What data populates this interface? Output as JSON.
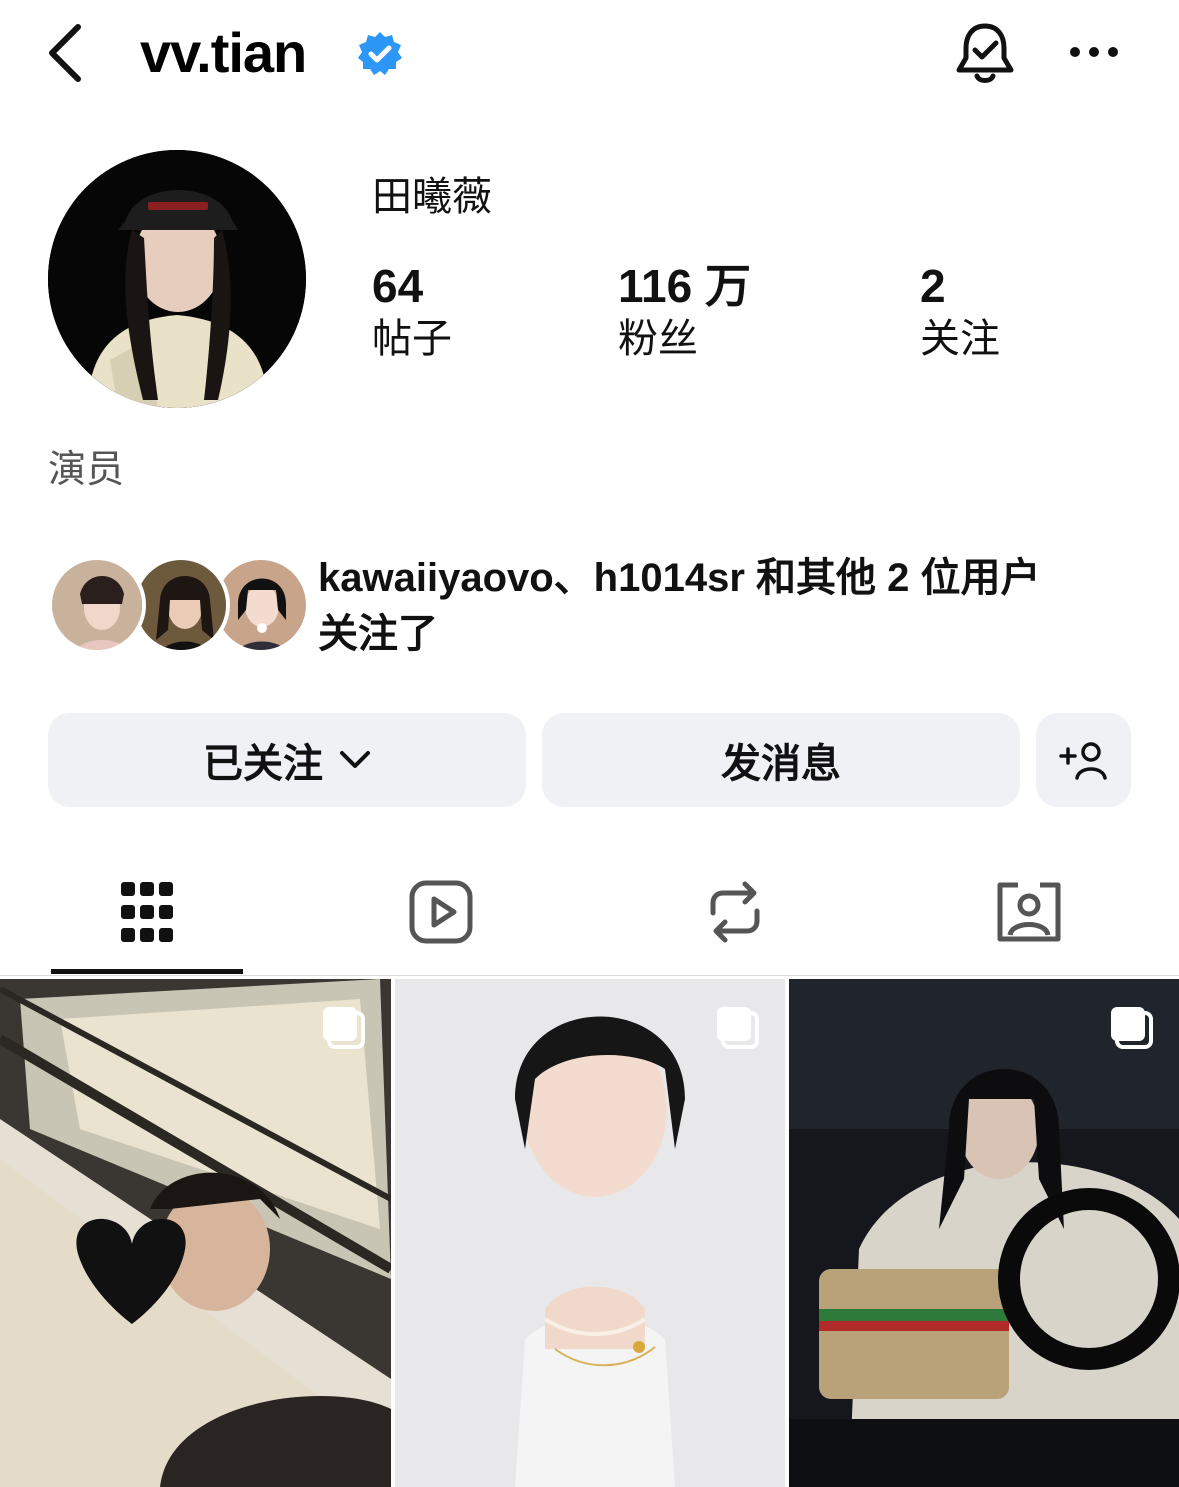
{
  "header": {
    "username": "vv.tian",
    "verified": true,
    "icons": [
      "back-arrow-icon",
      "verified-badge-icon",
      "notification-bell-icon",
      "more-options-icon"
    ]
  },
  "profile": {
    "display_name": "田曦薇",
    "stats": [
      {
        "value": "64",
        "label": "帖子"
      },
      {
        "value": "116 万",
        "label": "粉丝"
      },
      {
        "value": "2",
        "label": "关注"
      }
    ],
    "bio": "演员"
  },
  "mutual": {
    "text_line1": "kawaiiyaovo、h1014sr 和其他 2 位用户",
    "text_line2": "关注了"
  },
  "actions": {
    "following_label": "已关注",
    "message_label": "发消息"
  },
  "tabs": [
    "grid-icon",
    "reels-icon",
    "reposts-icon",
    "tagged-icon"
  ],
  "colors": {
    "accent_verified": "#2c97f6",
    "button_bg": "#eff1f4",
    "text_primary": "#111111",
    "text_secondary": "#555555"
  }
}
